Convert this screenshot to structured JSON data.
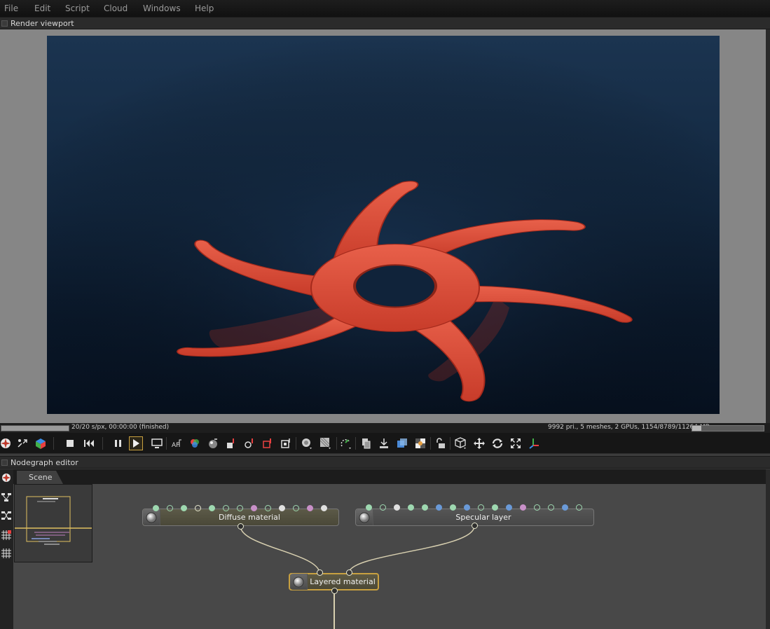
{
  "menu": [
    "File",
    "Edit",
    "Script",
    "Cloud",
    "Windows",
    "Help"
  ],
  "render_viewport": {
    "title": "Render viewport",
    "status_left": "20/20 s/px, 00:00:00 (finished)",
    "status_right": "9992 pri., 5 meshes, 2 GPUs, 1154/8789/11264 MB",
    "memory_fraction": 0.13
  },
  "toolbar": {
    "icons": [
      "camera-reset-icon",
      "recenter-view-icon",
      "render-region-icon",
      "stop-render-icon",
      "restart-render-icon",
      "pause-render-icon",
      "start-render-icon",
      "display-icon",
      "af-focus-icon",
      "white-balance-icon",
      "material-picker-icon",
      "object-picker-icon",
      "focus-picker-icon",
      "render-priority-icon",
      "clay-mode-icon",
      "subsample-icon",
      "decal-icon",
      "gizmo-icon",
      "copy-icon",
      "save-image-icon",
      "lock-viewport-icon",
      "cube-icon",
      "translate-icon",
      "rotate-icon",
      "scale-icon",
      "axis-icon"
    ],
    "active": "start-render-icon",
    "accent": "#c8a040"
  },
  "nodegraph": {
    "title": "Nodegraph editor",
    "tab": "Scene",
    "nodes": {
      "diffuse": {
        "label": "Diffuse material"
      },
      "specular": {
        "label": "Specular layer"
      },
      "layered": {
        "label": "Layered material"
      }
    }
  },
  "colors": {
    "logo": "#e0503a",
    "selected_node": "#c8a040"
  }
}
